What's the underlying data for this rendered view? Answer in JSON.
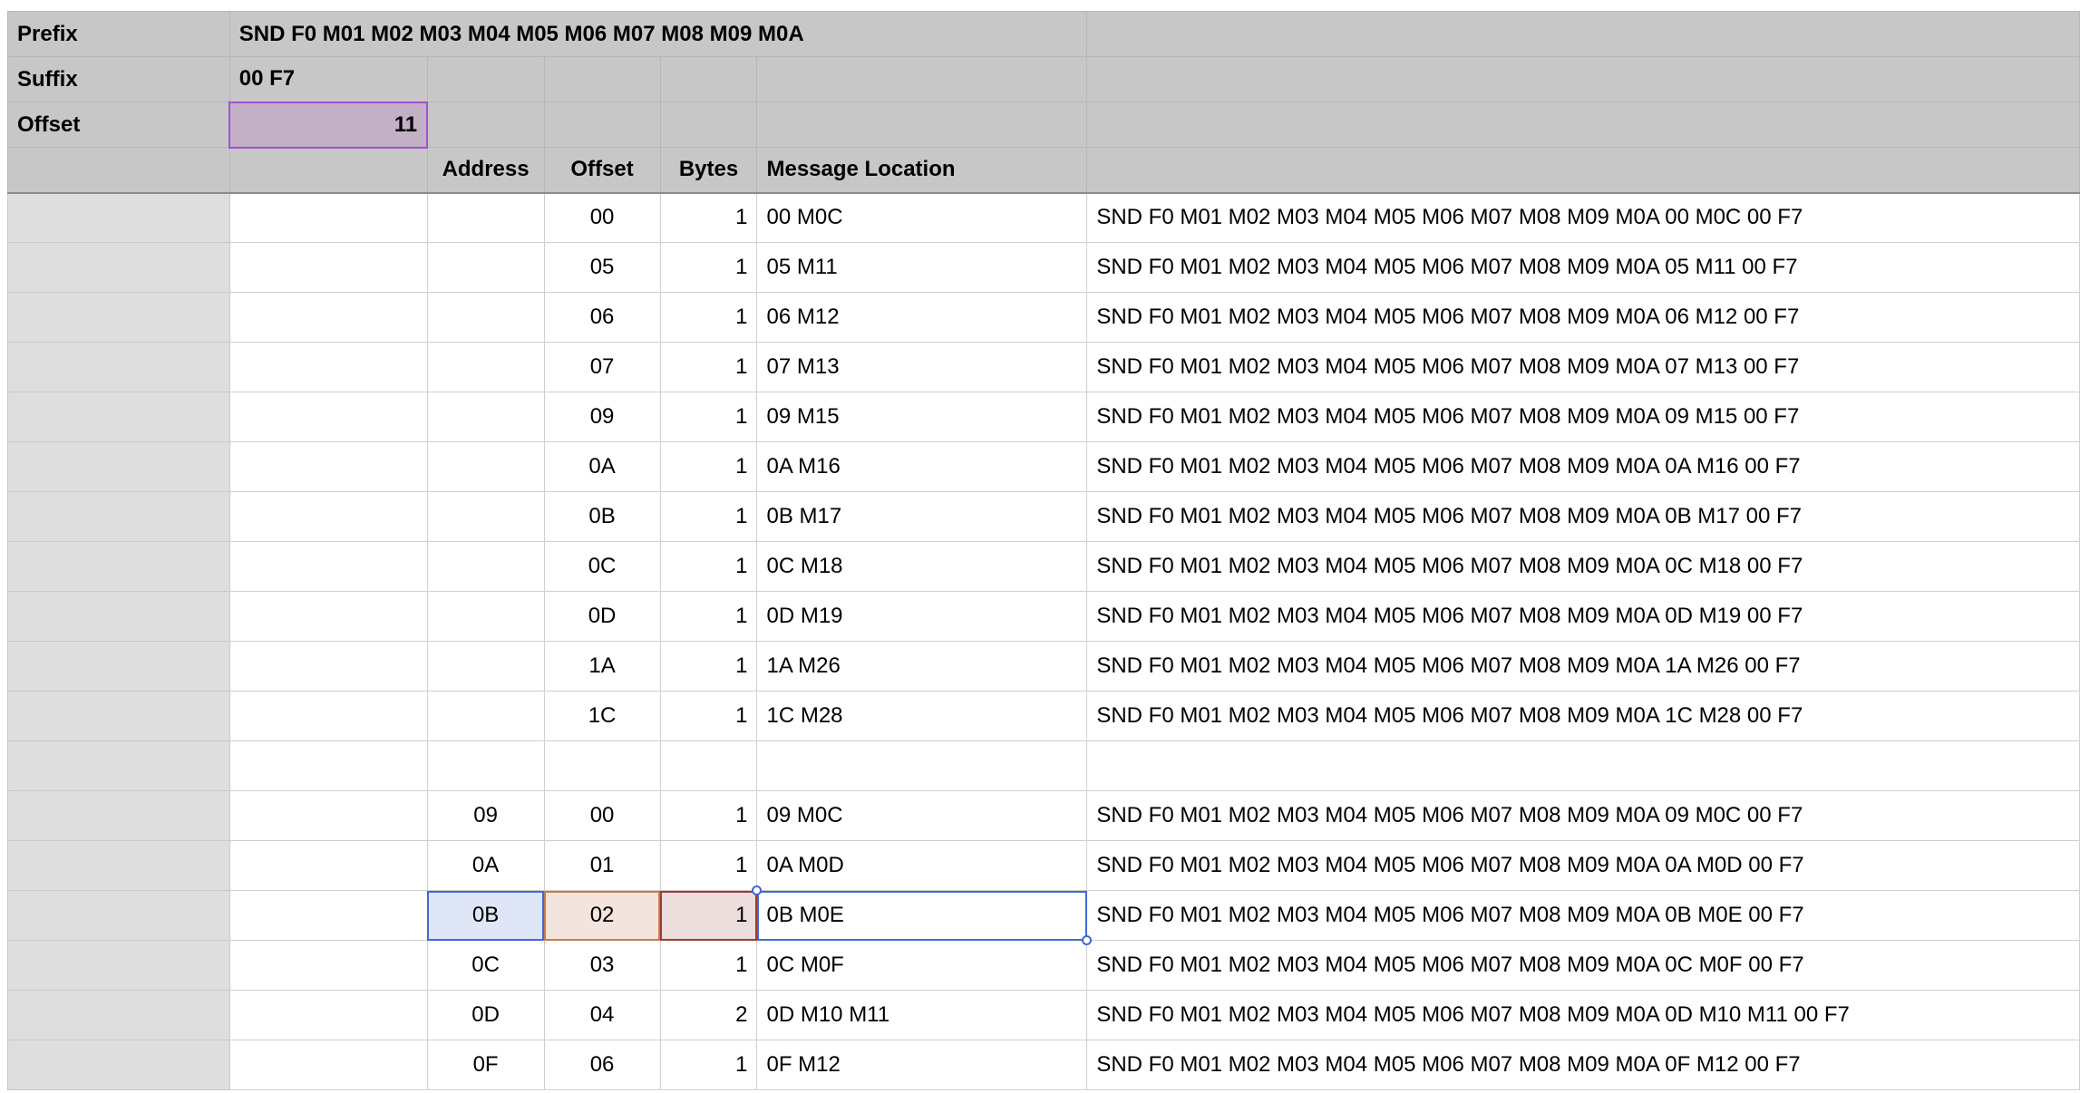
{
  "header": {
    "prefix_label": "Prefix",
    "prefix_value": "SND F0 M01 M02 M03 M04 M05 M06 M07 M08 M09 M0A",
    "suffix_label": "Suffix",
    "suffix_value": "00 F7",
    "offset_label": "Offset",
    "offset_value": "11"
  },
  "columns": {
    "address": "Address",
    "offset": "Offset",
    "bytes": "Bytes",
    "message_location": "Message Location"
  },
  "rows": [
    {
      "address": "",
      "offset": "00",
      "bytes": "1",
      "location": "00 M0C",
      "message": "SND F0 M01 M02 M03 M04 M05 M06 M07 M08 M09 M0A 00 M0C 00 F7"
    },
    {
      "address": "",
      "offset": "05",
      "bytes": "1",
      "location": "05 M11",
      "message": "SND F0 M01 M02 M03 M04 M05 M06 M07 M08 M09 M0A 05 M11 00 F7"
    },
    {
      "address": "",
      "offset": "06",
      "bytes": "1",
      "location": "06 M12",
      "message": "SND F0 M01 M02 M03 M04 M05 M06 M07 M08 M09 M0A 06 M12 00 F7"
    },
    {
      "address": "",
      "offset": "07",
      "bytes": "1",
      "location": "07 M13",
      "message": "SND F0 M01 M02 M03 M04 M05 M06 M07 M08 M09 M0A 07 M13 00 F7"
    },
    {
      "address": "",
      "offset": "09",
      "bytes": "1",
      "location": "09 M15",
      "message": "SND F0 M01 M02 M03 M04 M05 M06 M07 M08 M09 M0A 09 M15 00 F7"
    },
    {
      "address": "",
      "offset": "0A",
      "bytes": "1",
      "location": "0A M16",
      "message": "SND F0 M01 M02 M03 M04 M05 M06 M07 M08 M09 M0A 0A M16 00 F7"
    },
    {
      "address": "",
      "offset": "0B",
      "bytes": "1",
      "location": "0B M17",
      "message": "SND F0 M01 M02 M03 M04 M05 M06 M07 M08 M09 M0A 0B M17 00 F7"
    },
    {
      "address": "",
      "offset": "0C",
      "bytes": "1",
      "location": "0C M18",
      "message": "SND F0 M01 M02 M03 M04 M05 M06 M07 M08 M09 M0A 0C M18 00 F7"
    },
    {
      "address": "",
      "offset": "0D",
      "bytes": "1",
      "location": "0D M19",
      "message": "SND F0 M01 M02 M03 M04 M05 M06 M07 M08 M09 M0A 0D M19 00 F7"
    },
    {
      "address": "",
      "offset": "1A",
      "bytes": "1",
      "location": "1A M26",
      "message": "SND F0 M01 M02 M03 M04 M05 M06 M07 M08 M09 M0A 1A M26 00 F7"
    },
    {
      "address": "",
      "offset": "1C",
      "bytes": "1",
      "location": "1C M28",
      "message": "SND F0 M01 M02 M03 M04 M05 M06 M07 M08 M09 M0A 1C M28 00 F7"
    },
    {
      "address": "",
      "offset": "",
      "bytes": "",
      "location": "",
      "message": ""
    },
    {
      "address": "09",
      "offset": "00",
      "bytes": "1",
      "location": "09 M0C",
      "message": "SND F0 M01 M02 M03 M04 M05 M06 M07 M08 M09 M0A 09 M0C 00 F7"
    },
    {
      "address": "0A",
      "offset": "01",
      "bytes": "1",
      "location": "0A M0D",
      "message": "SND F0 M01 M02 M03 M04 M05 M06 M07 M08 M09 M0A 0A M0D 00 F7"
    },
    {
      "address": "0B",
      "offset": "02",
      "bytes": "1",
      "location": "0B M0E",
      "message": "SND F0 M01 M02 M03 M04 M05 M06 M07 M08 M09 M0A 0B M0E 00 F7"
    },
    {
      "address": "0C",
      "offset": "03",
      "bytes": "1",
      "location": "0C M0F",
      "message": "SND F0 M01 M02 M03 M04 M05 M06 M07 M08 M09 M0A 0C M0F 00 F7"
    },
    {
      "address": "0D",
      "offset": "04",
      "bytes": "2",
      "location": "0D M10 M11",
      "message": "SND F0 M01 M02 M03 M04 M05 M06 M07 M08 M09 M0A 0D M10 M11 00 F7"
    },
    {
      "address": "0F",
      "offset": "06",
      "bytes": "1",
      "location": "0F M12",
      "message": "SND F0 M01 M02 M03 M04 M05 M06 M07 M08 M09 M0A 0F M12 00 F7"
    }
  ]
}
